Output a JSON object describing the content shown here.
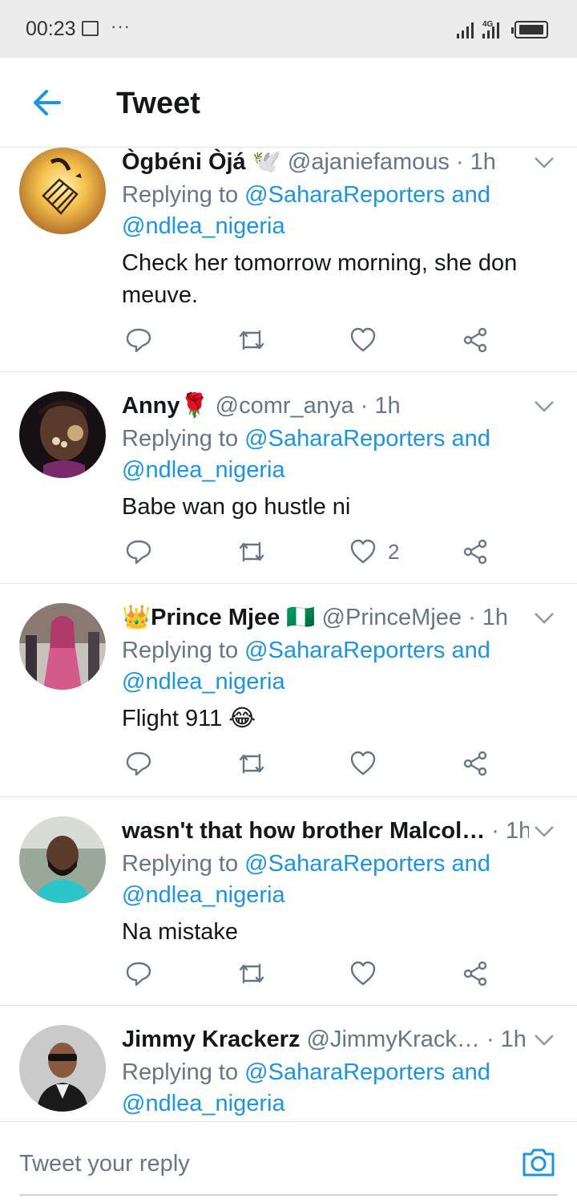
{
  "status_bar": {
    "time": "00:23",
    "network": "4G",
    "icons": [
      "image-icon",
      "more-dots-icon",
      "signal-icon",
      "battery-icon"
    ]
  },
  "header": {
    "title": "Tweet",
    "back_icon": "back-arrow-icon"
  },
  "colors": {
    "accent": "#1b95e0",
    "secondary_text": "#657786",
    "divider": "#dfe3e6",
    "status_bar_bg": "#ececec"
  },
  "tweets": [
    {
      "name": "Ògbéni Òjá 🕊️",
      "handle": "@ajaniefamous",
      "time": "· 1h",
      "replying_prefix": "Replying to",
      "replying_to_1": "@SaharaReporters and",
      "replying_to_2": "@ndlea_nigeria",
      "text": "Check her tomorrow morning, she don meuve.",
      "reply_count": "",
      "retweet_count": "",
      "like_count": ""
    },
    {
      "name": "Anny🌹",
      "handle": "@comr_anya",
      "time": "· 1h",
      "replying_prefix": "Replying to",
      "replying_to_1": "@SaharaReporters and",
      "replying_to_2": "@ndlea_nigeria",
      "text": "Babe wan go hustle ni",
      "reply_count": "",
      "retweet_count": "",
      "like_count": "2"
    },
    {
      "name": "👑Prince Mjee 🇳🇬",
      "handle": "@PrinceMjee",
      "time": "· 1h",
      "replying_prefix": "Replying to",
      "replying_to_1": "@SaharaReporters and",
      "replying_to_2": "@ndlea_nigeria",
      "text": "Flight 911 😂",
      "reply_count": "",
      "retweet_count": "",
      "like_count": ""
    },
    {
      "name": "wasn't that how brother Malcol…",
      "handle": "",
      "time": "· 1h",
      "replying_prefix": "Replying to",
      "replying_to_1": "@SaharaReporters and",
      "replying_to_2": "@ndlea_nigeria",
      "text": "Na mistake",
      "reply_count": "",
      "retweet_count": "",
      "like_count": ""
    },
    {
      "name": "Jimmy Krackerz",
      "handle": "@JimmyKrack…",
      "time": "· 1h",
      "replying_prefix": "Replying to",
      "replying_to_1": "@SaharaReporters and",
      "replying_to_2": "@ndlea_nigeria",
      "text": "",
      "reply_count": "",
      "retweet_count": "",
      "like_count": ""
    }
  ],
  "reply_bar": {
    "placeholder": "Tweet your reply",
    "camera_icon": "camera-icon"
  }
}
